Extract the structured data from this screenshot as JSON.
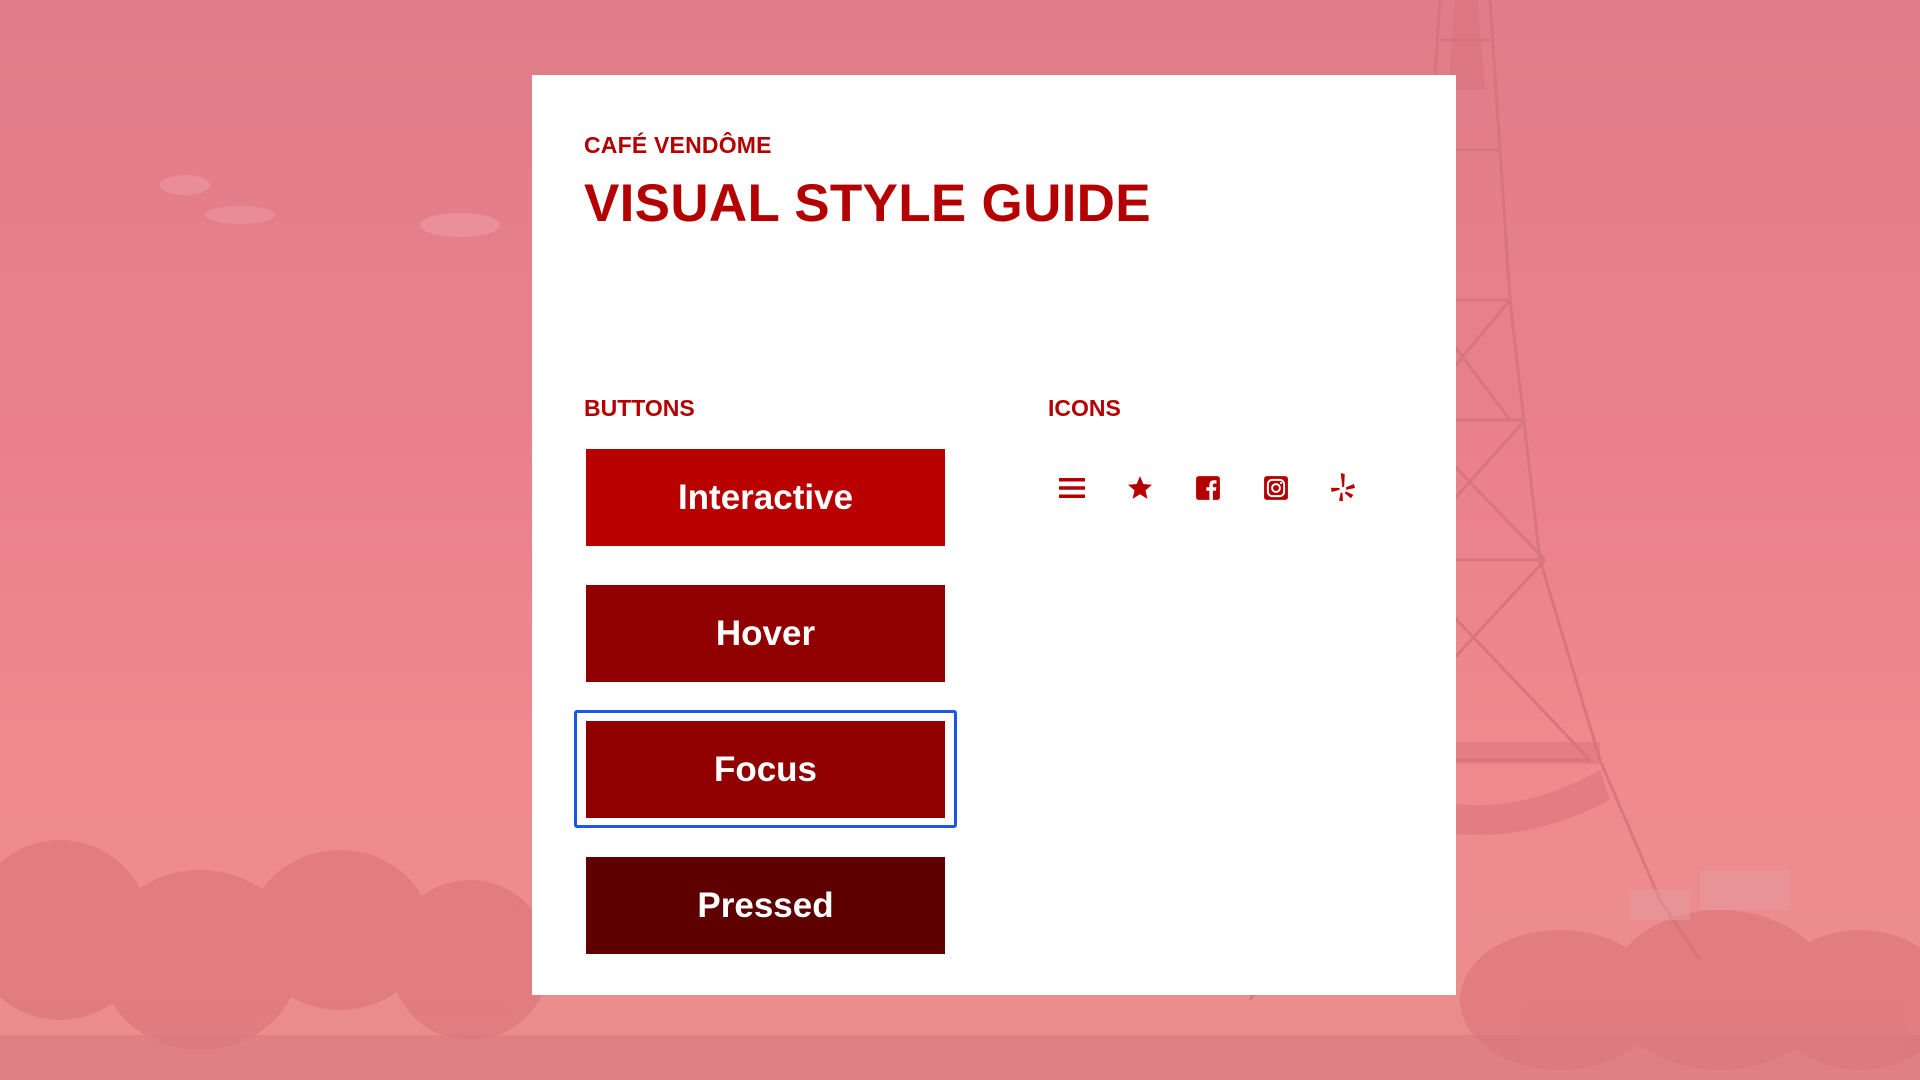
{
  "header": {
    "brand": "CAFÉ VENDÔME",
    "title": "VISUAL STYLE GUIDE"
  },
  "buttons_section": {
    "heading": "BUTTONS",
    "buttons": [
      {
        "label": "Interactive",
        "state": "interactive",
        "color": "#b80000"
      },
      {
        "label": "Hover",
        "state": "hover",
        "color": "#910000"
      },
      {
        "label": "Focus",
        "state": "focus",
        "color": "#910000"
      },
      {
        "label": "Pressed",
        "state": "pressed",
        "color": "#5e0000"
      }
    ],
    "focus_ring_color": "#1a56e8"
  },
  "icons_section": {
    "heading": "ICONS",
    "icons": [
      "menu-icon",
      "star-icon",
      "facebook-icon",
      "instagram-icon",
      "yelp-icon"
    ]
  },
  "colors": {
    "brand": "#b40000",
    "background_tint": "#e98089"
  }
}
